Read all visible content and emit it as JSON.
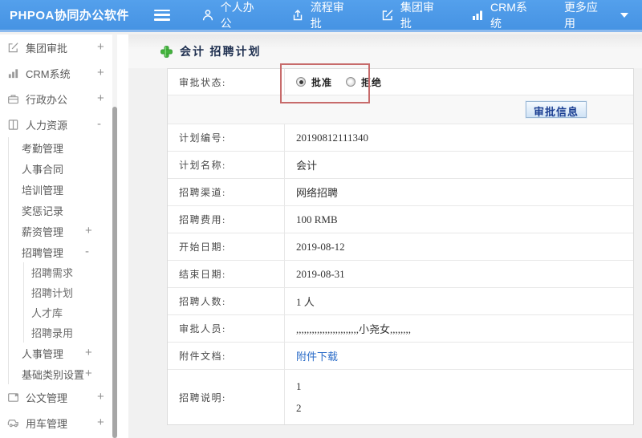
{
  "header": {
    "brand": "PHPOA协同办公软件",
    "nav": [
      {
        "label": "个人办公",
        "icon": "user-icon"
      },
      {
        "label": "流程审批",
        "icon": "export-icon"
      },
      {
        "label": "集团审批",
        "icon": "edit-icon"
      },
      {
        "label": "CRM系统",
        "icon": "bar-chart-icon"
      },
      {
        "label": "更多应用",
        "icon": "caret-down-icon"
      }
    ]
  },
  "sidebar": {
    "items": [
      {
        "label": "集团审批",
        "icon": "edit-icon",
        "toggle": "+"
      },
      {
        "label": "CRM系统",
        "icon": "bar-chart-icon",
        "toggle": "+"
      },
      {
        "label": "行政办公",
        "icon": "briefcase-icon",
        "toggle": "+"
      },
      {
        "label": "人力资源",
        "icon": "book-icon",
        "toggle": "-"
      },
      {
        "label": "考勤管理"
      },
      {
        "label": "人事合同"
      },
      {
        "label": "培训管理"
      },
      {
        "label": "奖惩记录"
      },
      {
        "label": "薪资管理",
        "toggle": "+"
      },
      {
        "label": "招聘管理",
        "toggle": "-"
      },
      {
        "label": "招聘需求"
      },
      {
        "label": "招聘计划"
      },
      {
        "label": "人才库"
      },
      {
        "label": "招聘录用"
      },
      {
        "label": "人事管理",
        "toggle": "+"
      },
      {
        "label": "基础类别设置",
        "toggle": "+"
      },
      {
        "label": "公文管理",
        "icon": "document-icon",
        "toggle": "+"
      },
      {
        "label": "用车管理",
        "icon": "car-icon",
        "toggle": "+"
      }
    ]
  },
  "main": {
    "page_title": "会计 招聘计划",
    "status": {
      "label": "审批状态:",
      "options": [
        {
          "label": "批准",
          "checked": true
        },
        {
          "label": "拒绝",
          "checked": false
        }
      ]
    },
    "approve_info_button": "审批信息",
    "fields": [
      {
        "label": "计划编号:",
        "value": "20190812111340"
      },
      {
        "label": "计划名称:",
        "value": "会计"
      },
      {
        "label": "招聘渠道:",
        "value": "网络招聘"
      },
      {
        "label": "招聘费用:",
        "value": "100 RMB"
      },
      {
        "label": "开始日期:",
        "value": "2019-08-12"
      },
      {
        "label": "结束日期:",
        "value": "2019-08-31"
      },
      {
        "label": "招聘人数:",
        "value": "1 人"
      },
      {
        "label": "审批人员:",
        "value": ",,,,,,,,,,,,,,,,,,,,,,,,小尧女,,,,,,,,"
      },
      {
        "label": "附件文档:",
        "value": "附件下载"
      }
    ],
    "description": {
      "label": "招聘说明:",
      "lines": [
        "1",
        "2"
      ]
    }
  },
  "colors": {
    "header_bg": "#4a97e8",
    "highlight_box": "#c76b6b",
    "link": "#2b6cc8",
    "button_text": "#1a3e92",
    "plus_green": "#43b13c"
  }
}
